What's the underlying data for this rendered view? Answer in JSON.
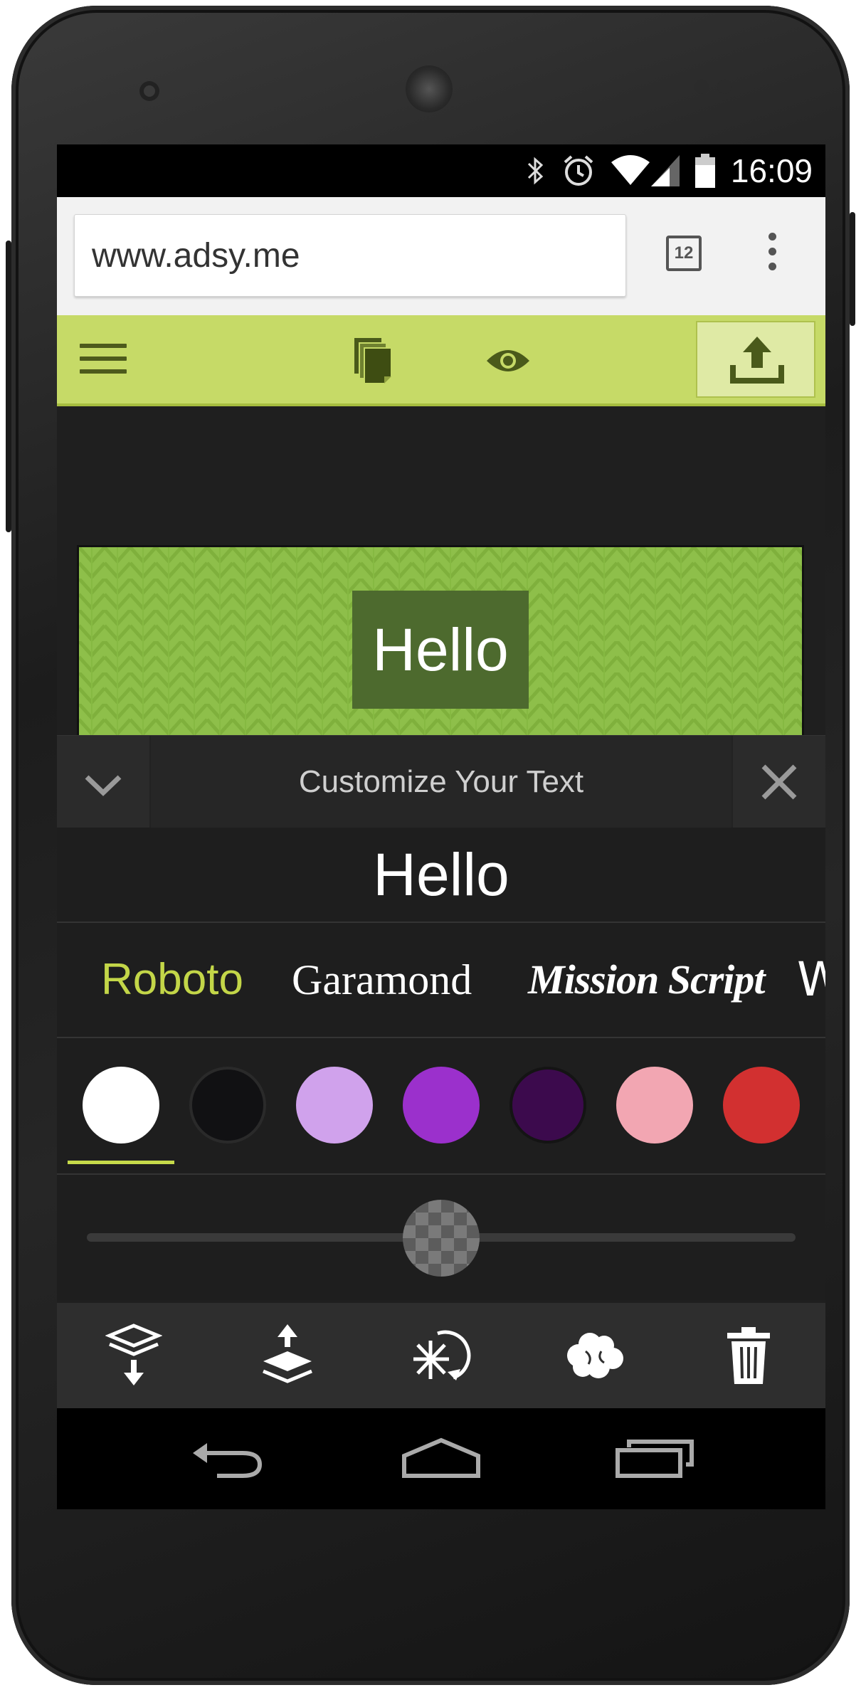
{
  "status_bar": {
    "time": "16:09",
    "icons": [
      "bluetooth-icon",
      "alarm-icon",
      "wifi-icon",
      "signal-icon",
      "battery-icon"
    ]
  },
  "browser": {
    "url": "www.adsy.me",
    "tab_count": "12",
    "menu_icon": "overflow-menu-icon"
  },
  "app_toolbar": {
    "icons": [
      "hamburger-menu-icon",
      "pages-icon",
      "preview-eye-icon",
      "upload-icon"
    ],
    "accent_color": "#c6da67"
  },
  "canvas": {
    "banner_text": "Hello",
    "banner_color": "#8ebf4a"
  },
  "panel": {
    "title": "Customize Your Text",
    "collapse_icon": "chevron-down-icon",
    "close_icon": "close-icon",
    "text_value": "Hello",
    "fonts": [
      {
        "label": "Roboto",
        "selected": true
      },
      {
        "label": "Garamond",
        "selected": false
      },
      {
        "label": "Mission Script",
        "selected": false
      },
      {
        "label": "W",
        "selected": false
      }
    ],
    "selected_font_color": "#c3d648",
    "colors": [
      {
        "hex": "#ffffff",
        "selected": true
      },
      {
        "hex": "#111113",
        "selected": false
      },
      {
        "hex": "#d0a2ec",
        "selected": false
      },
      {
        "hex": "#9b30cc",
        "selected": false
      },
      {
        "hex": "#3c0a4d",
        "selected": false
      },
      {
        "hex": "#f2a6b2",
        "selected": false
      },
      {
        "hex": "#d23030",
        "selected": false
      }
    ],
    "opacity_level": 0.5,
    "actions": [
      "send-backward-icon",
      "bring-forward-icon",
      "effects-rotate-icon",
      "shape-cloud-icon",
      "delete-trash-icon"
    ]
  },
  "system_nav": [
    "back-icon",
    "home-icon",
    "recents-icon"
  ]
}
